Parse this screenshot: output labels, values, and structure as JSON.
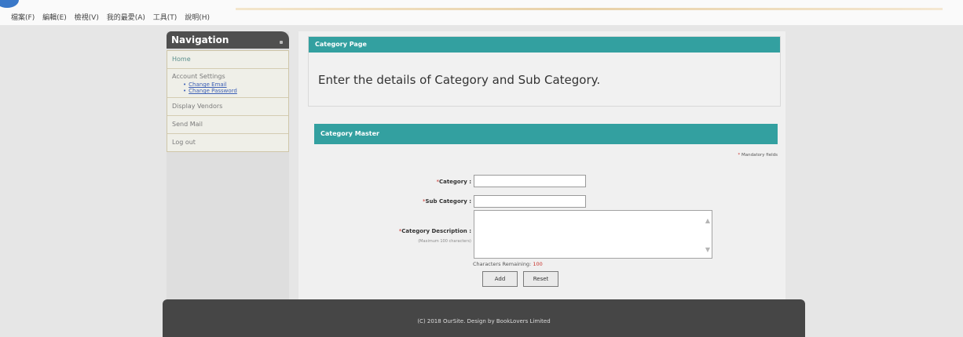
{
  "browser": {
    "menu": [
      "檔案(F)",
      "編輯(E)",
      "檢視(V)",
      "我的最愛(A)",
      "工具(T)",
      "說明(H)"
    ]
  },
  "nav": {
    "title": "Navigation",
    "items": {
      "home": "Home",
      "account": "Account Settings",
      "change_email": "Change Email",
      "change_password": "Change Password",
      "display_vendors": "Display Vendors",
      "send_mail": "Send Mail",
      "logout": "Log out"
    }
  },
  "category_page": {
    "header": "Category Page",
    "intro": "Enter the details of Category and Sub Category."
  },
  "category_master": {
    "header": "Category Master",
    "mandatory_note": "Mandatory fields",
    "star": "*",
    "fields": {
      "category": "Category :",
      "sub_category": "Sub Category :",
      "description": "Category Description :",
      "description_hint": "(Maximum 100 characters)"
    },
    "values": {
      "category": "",
      "sub_category": "",
      "description": ""
    },
    "remaining_label": "Characters Remaining:",
    "remaining_count": "100",
    "buttons": {
      "add": "Add",
      "reset": "Reset"
    }
  },
  "footer": {
    "text": "(C) 2018 OurSite. Design by BookLovers Limited"
  },
  "colors": {
    "teal": "#33a0a0",
    "nav_header": "#4f4f4f",
    "footer": "#464646",
    "required": "#c9322b",
    "link": "#3c5fb5"
  }
}
